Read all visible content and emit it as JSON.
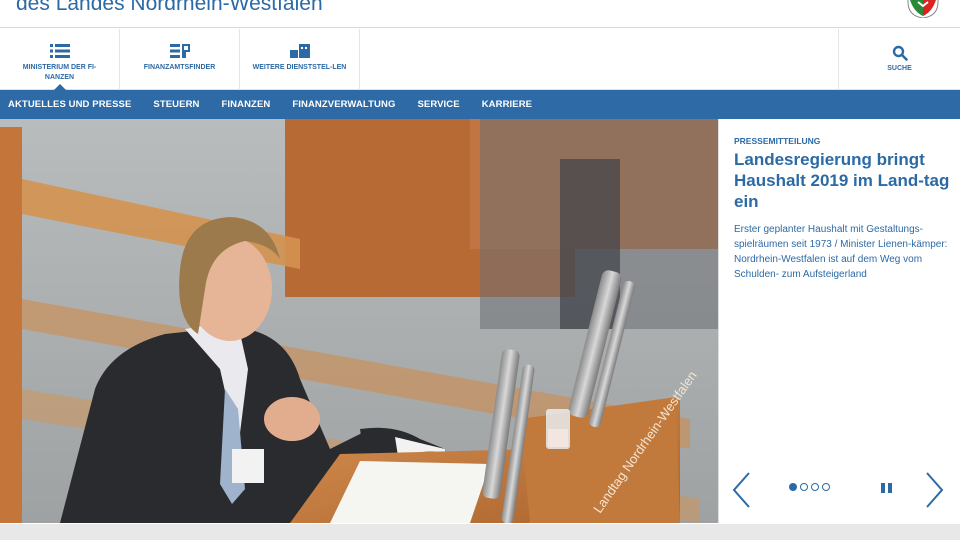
{
  "header": {
    "title": "des Landes Nordrhein-Westfalen"
  },
  "icon_nav": {
    "items": [
      {
        "label": "Ministerium der Fi-nanzen",
        "icon": "list-icon"
      },
      {
        "label": "Finanzamtsfinder",
        "icon": "finder-icon"
      },
      {
        "label": "Weitere Dienststel-len",
        "icon": "offices-icon"
      }
    ],
    "search_label": "Suche"
  },
  "main_nav": {
    "items": [
      "AKTUELLES UND PRESSE",
      "STEUERN",
      "FINANZEN",
      "FINANZVERWALTUNG",
      "SERVICE",
      "KARRIERE"
    ]
  },
  "teaser": {
    "kicker": "PRESSEMITTEILUNG",
    "title": "Landesregierung bringt Haushalt 2019 im Land-tag ein",
    "text": "Erster geplanter Haushalt mit Gestaltungs-spielräumen seit 1973 / Minister Lienen-kämper: Nordrhein-Westfalen ist auf dem Weg vom Schulden- zum Aufsteigerland"
  },
  "slider": {
    "dot_count": 4,
    "active_dot": 1
  },
  "colors": {
    "accent": "#2c6aa5",
    "nav_bar": "#2e6aa6"
  }
}
